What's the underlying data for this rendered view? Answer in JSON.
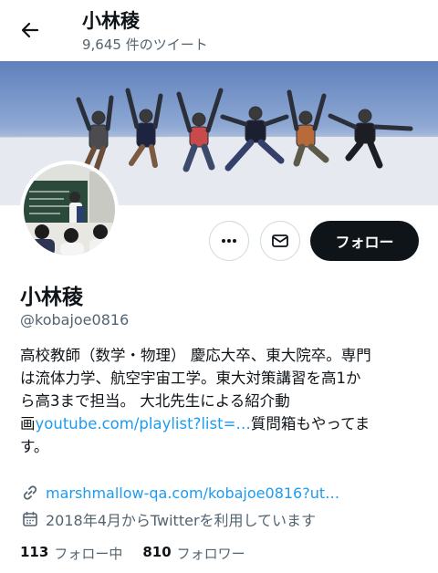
{
  "header": {
    "title": "小林稜",
    "tweet_count": "9,645 件のツイート"
  },
  "profile": {
    "display_name": "小林稜",
    "handle": "@kobajoe0816",
    "follow_label": "フォロー",
    "bio_lines": [
      "高校教師（数学・物理） 慶応大卒、東大院卒。専門",
      "は流体力学、航空宇宙工学。東大対策講習を高1か",
      "ら高3まで担当。 大北先生による紹介動"
    ],
    "bio_line4_pre": "画",
    "bio_link": "youtube.com/playlist?list=…",
    "bio_line4_post": "質問箱もやってま",
    "bio_line5": "す。",
    "website": "marshmallow-qa.com/kobajoe0816?ut…",
    "joined": "2018年4月からTwitterを利用しています",
    "following_count": "113",
    "following_label": "フォロー中",
    "followers_count": "810",
    "followers_label": "フォロワー"
  },
  "icons": {
    "back": "arrow-left-icon",
    "more": "more-icon",
    "mail": "mail-icon",
    "link": "link-icon",
    "calendar": "calendar-icon"
  },
  "colors": {
    "accent": "#1d9bf0",
    "primary_text": "#0f1419",
    "secondary_text": "#536471",
    "follow_button": "#0f1419"
  }
}
